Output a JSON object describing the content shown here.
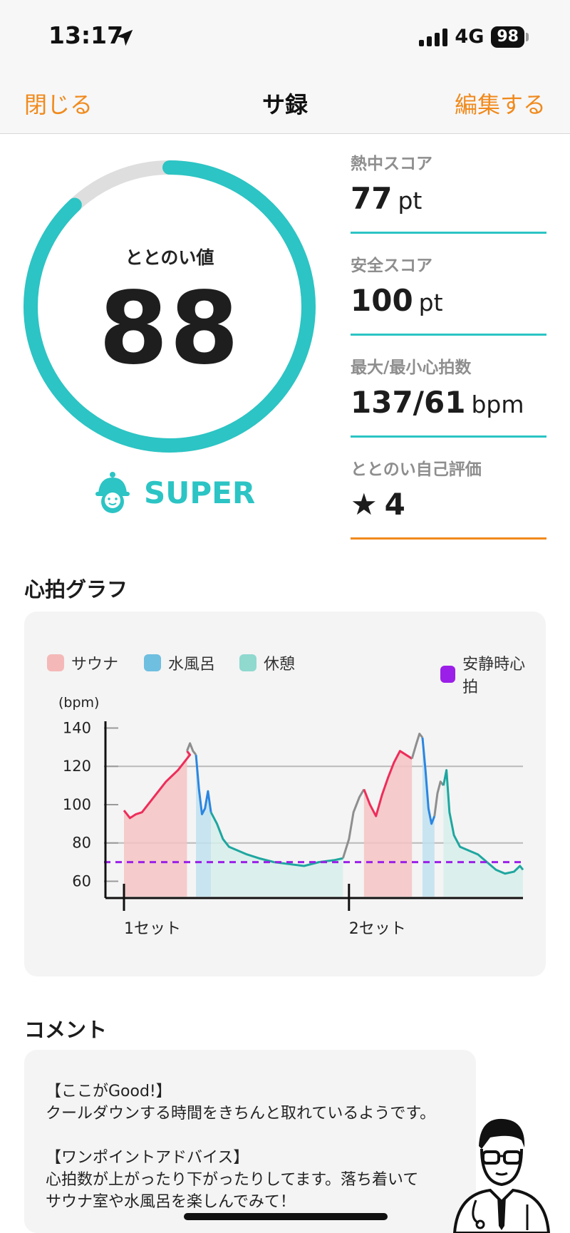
{
  "status_bar": {
    "time": "13:17",
    "network": "4G",
    "battery": "98"
  },
  "nav": {
    "close_label": "閉じる",
    "title": "サ録",
    "edit_label": "編集する"
  },
  "score": {
    "label": "ととのい値",
    "value": "88",
    "progress": 0.88,
    "level": "SUPER",
    "level_icon": "sauna-hat-face-icon"
  },
  "stats": [
    {
      "label": "熱中スコア",
      "value": "77",
      "unit": "pt"
    },
    {
      "label": "安全スコア",
      "value": "100",
      "unit": "pt"
    },
    {
      "label": "最大/最小心拍数",
      "value": "137/61",
      "unit": "bpm"
    },
    {
      "label": "ととのい自己評価",
      "value": "4",
      "icon": "star-icon"
    }
  ],
  "heart_graph": {
    "title": "心拍グラフ"
  },
  "chart_data": {
    "type": "area",
    "ylabel": "(bpm)",
    "yticks": [
      60,
      80,
      100,
      120,
      140
    ],
    "ylim": [
      52,
      145
    ],
    "xticks": [
      {
        "label": "1セット",
        "x": 0
      },
      {
        "label": "2セット",
        "x": 150
      }
    ],
    "xlim": [
      0,
      266
    ],
    "legend": [
      {
        "name": "サウナ",
        "color": "#f5b8b8"
      },
      {
        "name": "水風呂",
        "color": "#6fbfe0"
      },
      {
        "name": "休憩",
        "color": "#8fd9cf"
      },
      {
        "name": "安静時心拍",
        "color": "#9b1fe8"
      }
    ],
    "resting_hr": 70,
    "series": [
      {
        "name": "サウナ",
        "color": "#ee2d5a",
        "fill": "#f5c3c3",
        "points": [
          [
            0,
            97
          ],
          [
            4,
            93
          ],
          [
            8,
            95
          ],
          [
            12,
            96
          ],
          [
            16,
            100
          ],
          [
            20,
            104
          ],
          [
            24,
            108
          ],
          [
            28,
            112
          ],
          [
            32,
            115
          ],
          [
            36,
            118
          ],
          [
            40,
            122
          ],
          [
            42,
            124
          ],
          [
            44,
            126
          ],
          [
            42,
            128
          ]
        ]
      },
      {
        "name": "サウナ(移動)",
        "color": "#8e8e8e",
        "fill": "none",
        "points": [
          [
            42,
            128
          ],
          [
            44,
            132
          ],
          [
            46,
            128
          ],
          [
            48,
            126
          ]
        ]
      },
      {
        "name": "水風呂",
        "color": "#2b86e0",
        "fill": "#bfe0ee",
        "points": [
          [
            48,
            126
          ],
          [
            50,
            108
          ],
          [
            52,
            95
          ],
          [
            54,
            98
          ],
          [
            56,
            107
          ],
          [
            58,
            96
          ]
        ]
      },
      {
        "name": "休憩",
        "color": "#1fa6a0",
        "fill": "#d6efea",
        "points": [
          [
            58,
            96
          ],
          [
            62,
            90
          ],
          [
            66,
            82
          ],
          [
            70,
            78
          ],
          [
            76,
            76
          ],
          [
            82,
            74
          ],
          [
            90,
            72
          ],
          [
            100,
            70
          ],
          [
            110,
            69
          ],
          [
            120,
            68
          ],
          [
            130,
            70
          ],
          [
            140,
            71
          ],
          [
            146,
            72
          ]
        ]
      },
      {
        "name": "休憩(移動)",
        "color": "#8e8e8e",
        "fill": "none",
        "points": [
          [
            146,
            72
          ],
          [
            150,
            82
          ],
          [
            153,
            96
          ],
          [
            157,
            104
          ],
          [
            160,
            108
          ]
        ]
      },
      {
        "name": "サウナ",
        "color": "#ee2d5a",
        "fill": "#f5c3c3",
        "points": [
          [
            160,
            108
          ],
          [
            164,
            100
          ],
          [
            168,
            94
          ],
          [
            172,
            105
          ],
          [
            176,
            114
          ],
          [
            180,
            122
          ],
          [
            184,
            128
          ],
          [
            188,
            126
          ],
          [
            192,
            124
          ]
        ]
      },
      {
        "name": "サウナ(移動)",
        "color": "#8e8e8e",
        "fill": "none",
        "points": [
          [
            192,
            124
          ],
          [
            195,
            132
          ],
          [
            197,
            137
          ],
          [
            199,
            135
          ]
        ]
      },
      {
        "name": "水風呂",
        "color": "#2b86e0",
        "fill": "#bfe0ee",
        "points": [
          [
            199,
            135
          ],
          [
            201,
            118
          ],
          [
            203,
            98
          ],
          [
            205,
            90
          ],
          [
            207,
            94
          ]
        ]
      },
      {
        "name": "休憩(移動)",
        "color": "#8e8e8e",
        "fill": "none",
        "points": [
          [
            207,
            94
          ],
          [
            209,
            106
          ],
          [
            211,
            112
          ],
          [
            213,
            110
          ]
        ]
      },
      {
        "name": "休憩",
        "color": "#1fa6a0",
        "fill": "#d6efea",
        "points": [
          [
            213,
            110
          ],
          [
            215,
            118
          ],
          [
            217,
            96
          ],
          [
            220,
            84
          ],
          [
            224,
            78
          ],
          [
            230,
            76
          ],
          [
            236,
            74
          ],
          [
            242,
            70
          ],
          [
            248,
            66
          ],
          [
            254,
            64
          ],
          [
            260,
            65
          ],
          [
            264,
            68
          ],
          [
            266,
            66
          ]
        ]
      }
    ]
  },
  "comment": {
    "title": "コメント",
    "lines": [
      "【ここがGood!】",
      "クールダウンする時間をきちんと取れているようです。",
      "",
      "【ワンポイントアドバイス】",
      "心拍数が上がったり下がったりしてます。落ち着いて",
      "サウナ室や水風呂を楽しんでみて！"
    ],
    "avatar_icon": "doctor-avatar-icon"
  },
  "colors": {
    "accent": "#2cc4c4",
    "orange": "#f08a1d",
    "purple": "#9b1fe8"
  }
}
